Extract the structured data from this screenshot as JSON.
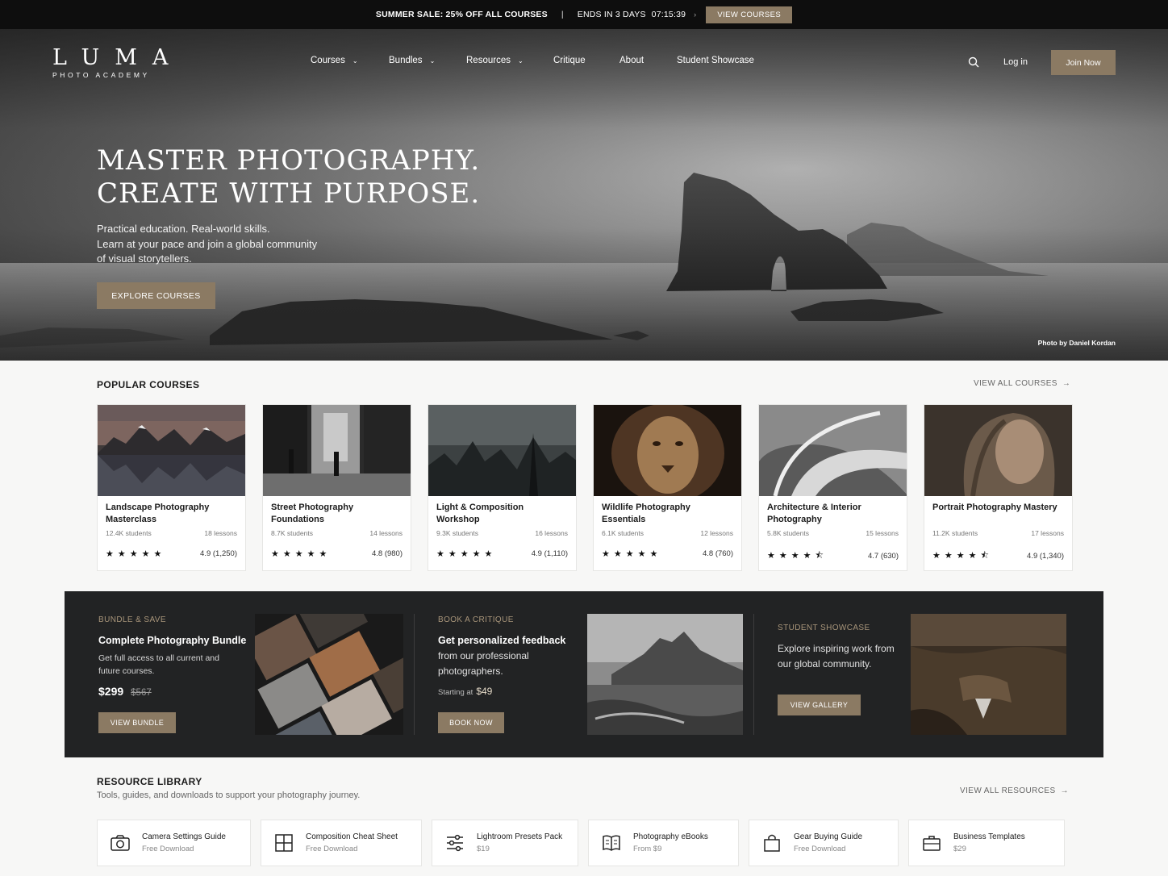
{
  "announcement": {
    "sale": "SUMMER SALE: 25% OFF ALL COURSES",
    "separator": "|",
    "ends": "ENDS IN 3 DAYS",
    "timer": "07:15:39",
    "chevron": "›",
    "button": "VIEW COURSES"
  },
  "brand": {
    "name": "LUMA",
    "tagline": "PHOTO ACADEMY"
  },
  "nav": {
    "items": [
      {
        "label": "Courses",
        "has_caret": true
      },
      {
        "label": "Bundles",
        "has_caret": true
      },
      {
        "label": "Resources",
        "has_caret": true
      },
      {
        "label": "Critique",
        "has_caret": false
      },
      {
        "label": "About",
        "has_caret": false
      },
      {
        "label": "Student Showcase",
        "has_caret": false
      }
    ],
    "search_icon": "search-icon",
    "login": "Log in",
    "join": "Join Now"
  },
  "hero": {
    "title_line1": "MASTER PHOTOGRAPHY.",
    "title_line2": "CREATE WITH PURPOSE.",
    "sub_line1": "Practical education. Real-world skills.",
    "sub_line2": "Learn at your pace and join a global community",
    "sub_line3": "of visual storytellers.",
    "cta": "EXPLORE COURSES",
    "credit": "Photo by Daniel Kordan"
  },
  "popular": {
    "title": "POPULAR COURSES",
    "view_all": "VIEW ALL COURSES",
    "arrow": "→",
    "courses": [
      {
        "title": "Landscape Photography Masterclass",
        "students": "12.4K students",
        "lessons": "18 lessons",
        "stars": "★★★★★",
        "rating": "4.9 (1,250)"
      },
      {
        "title": "Street Photography Foundations",
        "students": "8.7K students",
        "lessons": "14 lessons",
        "stars": "★★★★★",
        "rating": "4.8 (980)"
      },
      {
        "title": "Light & Composition Workshop",
        "students": "9.3K students",
        "lessons": "16 lessons",
        "stars": "★★★★★",
        "rating": "4.9 (1,110)"
      },
      {
        "title": "Wildlife Photography Essentials",
        "students": "6.1K students",
        "lessons": "12 lessons",
        "stars": "★★★★★",
        "rating": "4.8 (760)"
      },
      {
        "title": "Architecture & Interior Photography",
        "students": "5.8K students",
        "lessons": "15 lessons",
        "stars": "★★★★⯪",
        "rating": "4.7 (630)"
      },
      {
        "title": "Portrait Photography Mastery",
        "students": "11.2K students",
        "lessons": "17 lessons",
        "stars": "★★★★⯪",
        "rating": "4.9 (1,340)"
      }
    ]
  },
  "promos": {
    "bundle": {
      "label": "BUNDLE & SAVE",
      "title": "Complete Photography Bundle",
      "text_line1": "Get full access to all current and",
      "text_line2": "future courses.",
      "price": "$299",
      "old_price": "$567",
      "button": "VIEW BUNDLE"
    },
    "critique": {
      "label": "BOOK A CRITIQUE",
      "title": "Get personalized feedback",
      "text_line1": "from our professional",
      "text_line2": "photographers.",
      "starting": "Starting at",
      "price": "$49",
      "button": "BOOK NOW"
    },
    "showcase": {
      "label": "STUDENT SHOWCASE",
      "text_line1": "Explore inspiring work from",
      "text_line2": "our global community.",
      "button": "VIEW GALLERY"
    }
  },
  "resources": {
    "title": "RESOURCE LIBRARY",
    "subtitle": "Tools, guides, and downloads to support your photography journey.",
    "view_all": "VIEW ALL RESOURCES",
    "arrow": "→",
    "items": [
      {
        "icon": "camera-icon",
        "title": "Camera Settings Guide",
        "sub": "Free Download"
      },
      {
        "icon": "grid-icon",
        "title": "Composition Cheat Sheet",
        "sub": "Free Download"
      },
      {
        "icon": "sliders-icon",
        "title": "Lightroom Presets Pack",
        "sub": "$19"
      },
      {
        "icon": "book-icon",
        "title": "Photography eBooks",
        "sub": "From $9"
      },
      {
        "icon": "bag-icon",
        "title": "Gear Buying Guide",
        "sub": "Free Download"
      },
      {
        "icon": "briefcase-icon",
        "title": "Business Templates",
        "sub": "$29"
      }
    ]
  },
  "colors": {
    "accent": "#8b7a63",
    "dark_band": "#222324",
    "top_bar": "#0e0e0e",
    "label_gold": "#a8957a"
  }
}
